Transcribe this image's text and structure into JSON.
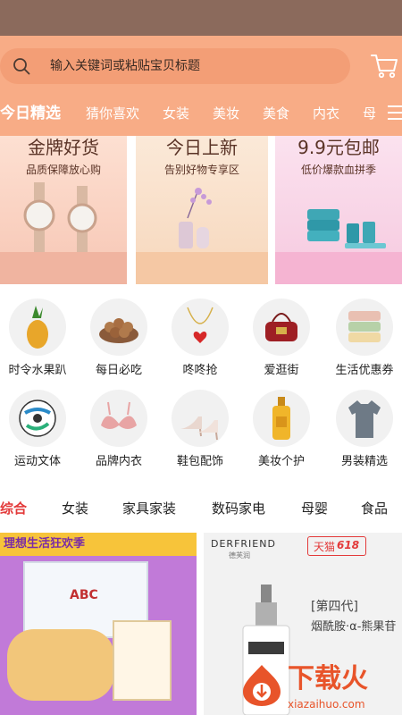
{
  "search": {
    "placeholder": "输入关键词或粘贴宝贝标题",
    "icon": "search-icon"
  },
  "header": {
    "cart_icon": "cart-icon",
    "menu_icon": "menu-icon"
  },
  "categories": [
    {
      "label": "今日精选",
      "active": true
    },
    {
      "label": "猜你喜欢"
    },
    {
      "label": "女装"
    },
    {
      "label": "美妆"
    },
    {
      "label": "美食"
    },
    {
      "label": "内衣"
    },
    {
      "label": "母"
    }
  ],
  "promos": [
    {
      "title": "金牌好货",
      "subtitle": "品质保障放心购",
      "image": "watches"
    },
    {
      "title": "今日上新",
      "subtitle": "告别好物专享区",
      "image": "vase-flowers"
    },
    {
      "title": "9.9元包邮",
      "subtitle": "低价爆款血拼季",
      "image": "towels-cups"
    }
  ],
  "grid": [
    {
      "label": "时令水果趴",
      "icon": "pineapple-icon"
    },
    {
      "label": "每日必吃",
      "icon": "nuts-icon"
    },
    {
      "label": "咚咚抢",
      "icon": "necklace-icon"
    },
    {
      "label": "爱逛街",
      "icon": "handbag-icon"
    },
    {
      "label": "生活优惠券",
      "icon": "towels-icon"
    },
    {
      "label": "运动文体",
      "icon": "soccer-ball-icon"
    },
    {
      "label": "品牌内衣",
      "icon": "bra-icon"
    },
    {
      "label": "鞋包配饰",
      "icon": "high-heels-icon"
    },
    {
      "label": "美妆个护",
      "icon": "perfume-icon"
    },
    {
      "label": "男装精选",
      "icon": "tshirt-icon"
    }
  ],
  "feed_tabs": [
    {
      "label": "综合",
      "active": true
    },
    {
      "label": "女装"
    },
    {
      "label": "家具家装"
    },
    {
      "label": "数码家电"
    },
    {
      "label": "母婴"
    },
    {
      "label": "食品"
    }
  ],
  "products": {
    "left": {
      "banner": "理想生活狂欢季",
      "box_text": "ABC"
    },
    "right": {
      "brand": "DERFRIEND",
      "brand_sub": "德芙润",
      "tmall": "天猫",
      "tmall_618": "618",
      "line1": "[第四代]",
      "line2": "烟酰胺·α-熊果苷"
    }
  },
  "watermark": {
    "text": "下载火",
    "url": "xiazaihuo.com"
  },
  "colors": {
    "header": "#f8ac86",
    "search": "#f39e76",
    "accent": "#e33a3a",
    "status": "#8b6a5c"
  }
}
